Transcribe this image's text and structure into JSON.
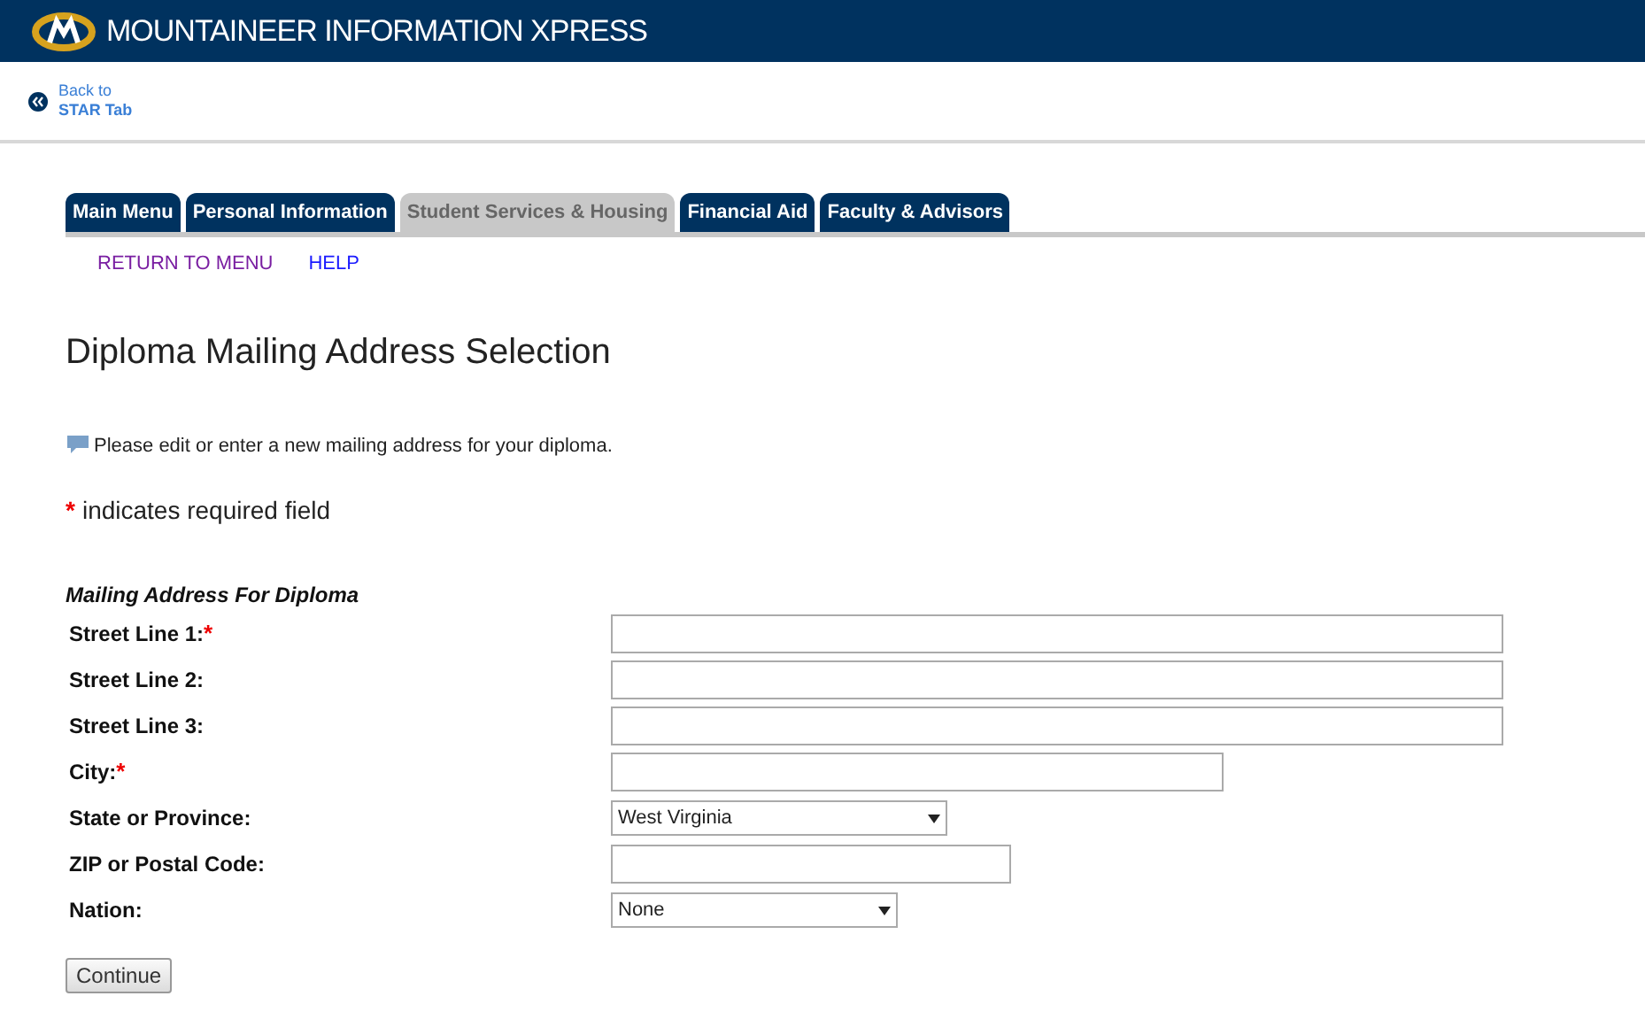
{
  "header": {
    "title": "MOUNTAINEER INFORMATION XPRESS"
  },
  "back_link": {
    "line_1": "Back to",
    "line_2": "STAR Tab"
  },
  "tabs": [
    {
      "label": "Main Menu",
      "selected": false
    },
    {
      "label": "Personal Information",
      "selected": false
    },
    {
      "label": "Student Services & Housing",
      "selected": true
    },
    {
      "label": "Financial Aid",
      "selected": false
    },
    {
      "label": "Faculty & Advisors",
      "selected": false
    }
  ],
  "submenu": [
    {
      "label": "RETURN TO MENU",
      "visited": true
    },
    {
      "label": "HELP",
      "visited": false
    }
  ],
  "page_title": "Diploma Mailing Address Selection",
  "info_text": "Please edit or enter a new mailing address for your diploma.",
  "required_legend": {
    "mark": "*",
    "text": "indicates required field"
  },
  "form": {
    "heading": "Mailing Address For Diploma",
    "fields": [
      {
        "label": "Street Line 1:",
        "required_mark": "*",
        "kind": "text"
      },
      {
        "label": "Street Line 2:",
        "kind": "text"
      },
      {
        "label": "Street Line 3:",
        "kind": "text"
      },
      {
        "label": "City:",
        "required_mark": "*",
        "kind": "text"
      },
      {
        "label": "State or Province:",
        "kind": "select",
        "value": "West Virginia"
      },
      {
        "label": "ZIP or Postal Code:",
        "kind": "text"
      },
      {
        "label": "Nation:",
        "kind": "select",
        "value": "None"
      }
    ]
  },
  "submit_button": "Continue"
}
